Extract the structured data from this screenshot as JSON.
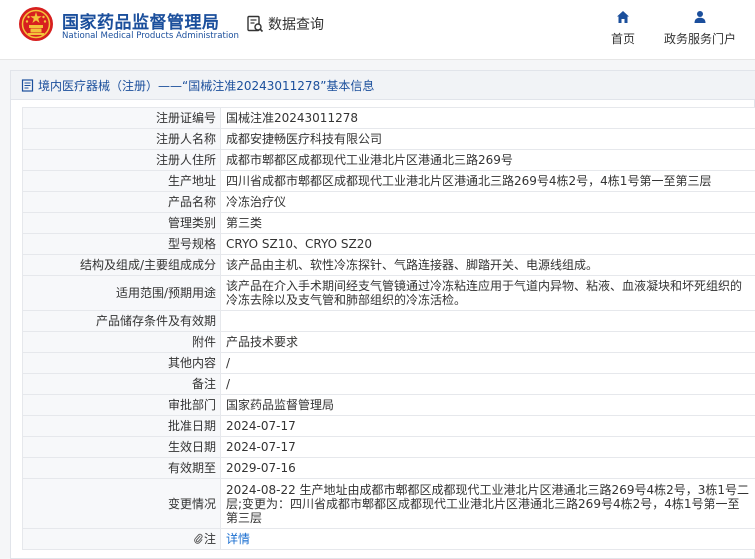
{
  "header": {
    "brand_cn": "国家药品监督管理局",
    "brand_en": "National Medical Products Administration",
    "query_label": "数据查询",
    "nav": [
      {
        "label": "首页",
        "icon": "home-icon"
      },
      {
        "label": "政务服务门户",
        "icon": "user-icon"
      }
    ],
    "colors": {
      "brand": "#1b4f9c",
      "emblem_red": "#d71f1f",
      "emblem_gold": "#f3c23a"
    }
  },
  "panel": {
    "title": "境内医疗器械（注册）——“国械注准20243011278”基本信息",
    "icon": "document-icon"
  },
  "rows": [
    {
      "label": "注册证编号",
      "value": "国械注准20243011278"
    },
    {
      "label": "注册人名称",
      "value": "成都安捷畅医疗科技有限公司"
    },
    {
      "label": "注册人住所",
      "value": "成都市郫都区成都现代工业港北片区港通北三路269号"
    },
    {
      "label": "生产地址",
      "value": "四川省成都市郫都区成都现代工业港北片区港通北三路269号4栋2号，4栋1号第一至第三层"
    },
    {
      "label": "产品名称",
      "value": "冷冻治疗仪"
    },
    {
      "label": "管理类别",
      "value": "第三类"
    },
    {
      "label": "型号规格",
      "value": "CRYO SZ10、CRYO SZ20"
    },
    {
      "label": "结构及组成/主要组成成分",
      "value": "该产品由主机、软性冷冻探针、气路连接器、脚踏开关、电源线组成。"
    },
    {
      "label": "适用范围/预期用途",
      "value": "该产品在介入手术期间经支气管镜通过冷冻粘连应用于气道内异物、粘液、血液凝块和坏死组织的冷冻去除以及支气管和肺部组织的冷冻活检。"
    },
    {
      "label": "产品储存条件及有效期",
      "value": ""
    },
    {
      "label": "附件",
      "value": "产品技术要求"
    },
    {
      "label": "其他内容",
      "value": "/"
    },
    {
      "label": "备注",
      "value": "/"
    },
    {
      "label": "审批部门",
      "value": "国家药品监督管理局"
    },
    {
      "label": "批准日期",
      "value": "2024-07-17"
    },
    {
      "label": "生效日期",
      "value": "2024-07-17"
    },
    {
      "label": "有效期至",
      "value": "2029-07-16"
    },
    {
      "label": "变更情况",
      "value": "2024-08-22 生产地址由成都市郫都区成都现代工业港北片区港通北三路269号4栋2号，3栋1号二层;变更为：四川省成都市郫都区成都现代工业港北片区港通北三路269号4栋2号，4栋1号第一至第三层"
    },
    {
      "label": "注",
      "label_icon": "paperclip-icon",
      "value": "详情"
    }
  ]
}
